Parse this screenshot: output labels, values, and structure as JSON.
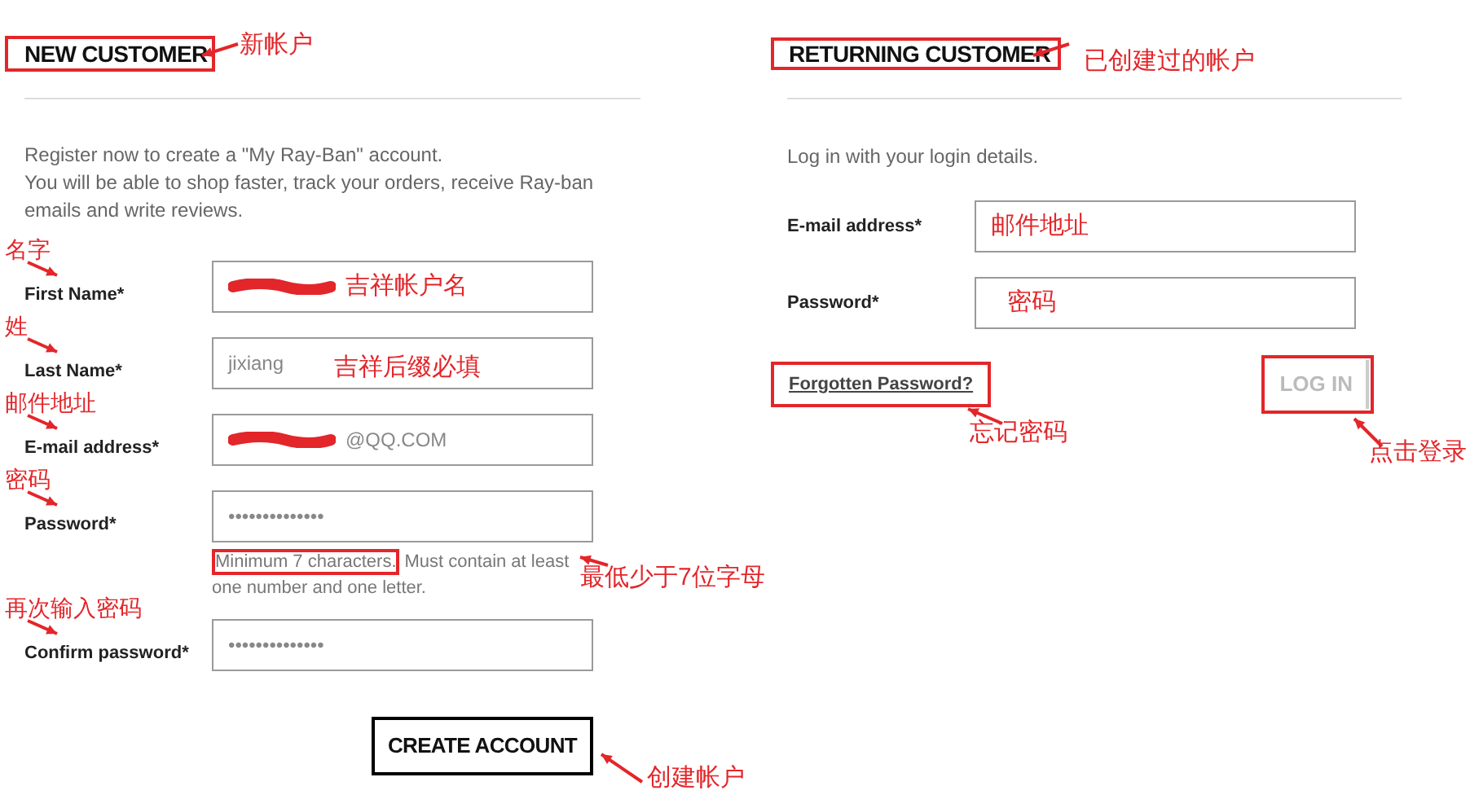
{
  "new_customer": {
    "heading": "NEW CUSTOMER",
    "heading_note": "新帐户",
    "intro": [
      "Register now to create a \"My Ray-Ban\" account.",
      "You will be able to shop faster, track your orders, receive Ray-ban emails and write reviews."
    ],
    "fields": [
      {
        "label": "First Name*",
        "marker": "名字",
        "redacted": true,
        "note": "吉祥帐户名"
      },
      {
        "label": "Last Name*",
        "marker": "姓",
        "value": "jixiang",
        "redacted": false,
        "note": "吉祥后缀必填"
      },
      {
        "label": "E-mail address*",
        "marker": "邮件地址",
        "value": "@QQ.COM",
        "redacted": true
      },
      {
        "label": "Password*",
        "marker": "密码",
        "value": "••••••••••••••",
        "redacted": false
      }
    ],
    "hint_boxed": "Minimum 7 characters.",
    "hint_rest": "Must contain at least one number and one letter.",
    "hint_note": "最低少于7位字母",
    "confirm": {
      "label": "Confirm password*",
      "marker": "再次输入密码",
      "value": "••••••••••••••"
    },
    "button": "CREATE ACCOUNT",
    "button_note": "创建帐户"
  },
  "returning_customer": {
    "heading": "RETURNING CUSTOMER",
    "heading_note": "已创建过的帐户",
    "intro": "Log in with your login details.",
    "fields": [
      {
        "label": "E-mail address*",
        "note": "邮件地址"
      },
      {
        "label": "Password*",
        "note": "密码"
      }
    ],
    "forgot_link": "Forgotten Password?",
    "forgot_note": "忘记密码",
    "button": "LOG IN",
    "button_disabled": true,
    "button_note": "点击登录"
  }
}
